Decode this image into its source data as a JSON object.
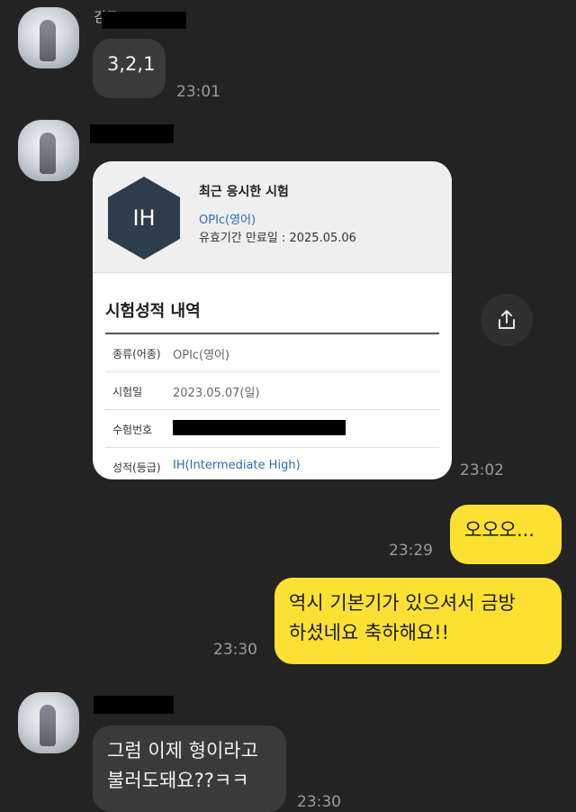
{
  "messages": {
    "m1": {
      "sender_prefix": "김도",
      "text": "3,2,1",
      "time": "23:01"
    },
    "m2": {
      "time": "23:02"
    },
    "m3": {
      "text": "오오오...",
      "time": "23:29"
    },
    "m4": {
      "text_line1": "역시 기본기가 있으셔서 금방",
      "text_line2": "하셨네요 축하해요!!",
      "time": "23:30"
    },
    "m5": {
      "text_line1": "그럼 이제 형이라고",
      "text_line2": "불러도돼요??ㅋㅋ",
      "time": "23:30"
    }
  },
  "card": {
    "badge": "IH",
    "title": "최근 응시한 시험",
    "exam": "OPIc(영어)",
    "validity": "유효기간 만료일 : 2025.05.06",
    "section_title": "시험성적 내역",
    "rows": [
      {
        "label": "종류(어종)",
        "value": "OPIc(영어)"
      },
      {
        "label": "시험일",
        "value": "2023.05.07(일)"
      },
      {
        "label": "수험번호",
        "value": ""
      },
      {
        "label": "성적(등급)",
        "value": "IH(Intermediate High)"
      }
    ]
  },
  "icons": {
    "share": "share-icon",
    "avatar": "avatar"
  },
  "colors": {
    "background": "#232323",
    "incoming_bubble": "#3a3a3a",
    "outgoing_bubble": "#fde132",
    "link_blue": "#2e6cb0"
  }
}
